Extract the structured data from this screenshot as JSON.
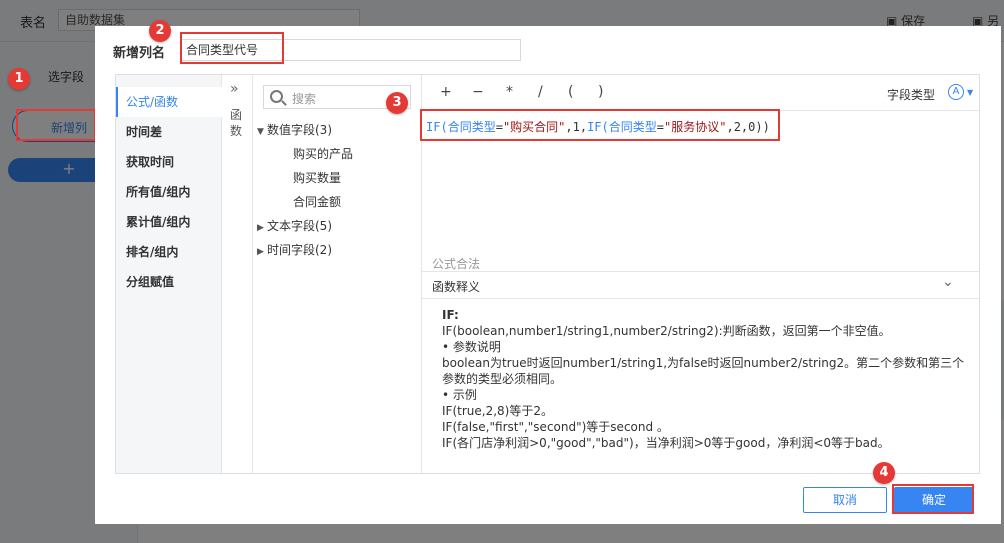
{
  "background": {
    "table_name_label": "表名",
    "table_name_value": "自助数据集",
    "save_label": "保存",
    "saveas_label": "另",
    "choose_fields_label": "选字段",
    "new_column_pill": "新增列",
    "add_button": "+"
  },
  "dialog": {
    "title": "新增列名",
    "column_name": "合同类型代号",
    "categories": [
      "公式/函数",
      "时间差",
      "获取时间",
      "所有值/组内",
      "累计值/组内",
      "排名/组内",
      "分组赋值"
    ],
    "function_toggle": "»",
    "function_vertical_label": "函数",
    "search_placeholder": "搜索",
    "field_groups": {
      "numeric": "数值字段(3)",
      "numeric_items": [
        "购买的产品",
        "购买数量",
        "合同金额"
      ],
      "text": "文本字段(5)",
      "time": "时间字段(2)"
    },
    "operators": [
      "+",
      "−",
      "*",
      "/",
      "(",
      ")"
    ],
    "field_type_label": "字段类型",
    "field_type_icon": "A",
    "formula": {
      "p1": "IF(",
      "f1": "合同类型",
      "p2": "=",
      "s1": "\"购买合同\"",
      "p3": ",1,",
      "p4": "IF(",
      "f2": "合同类型",
      "p5": "=",
      "s2": "\"服务协议\"",
      "p6": ",2,0))"
    },
    "formula_status": "公式合法",
    "explain_title": "函数释义",
    "explain_lines": [
      "IF:",
      "IF(boolean,number1/string1,number2/string2):判断函数，返回第一个非空值。",
      "• 参数说明",
      "boolean为true时返回number1/string1,为false时返回number2/string2。第二个参数和第三个参数的类型必须相同。",
      "• 示例",
      "IF(true,2,8)等于2。",
      "IF(false,\"first\",\"second\")等于second 。",
      "IF(各门店净利润>0,\"good\",\"bad\")，当净利润>0等于good，净利润<0等于bad。"
    ],
    "cancel_label": "取消",
    "confirm_label": "确定"
  },
  "annotations": [
    "1",
    "2",
    "3",
    "4"
  ],
  "colors": {
    "accent": "#3685f2",
    "annotation": "#e53935",
    "string": "#a31515"
  }
}
